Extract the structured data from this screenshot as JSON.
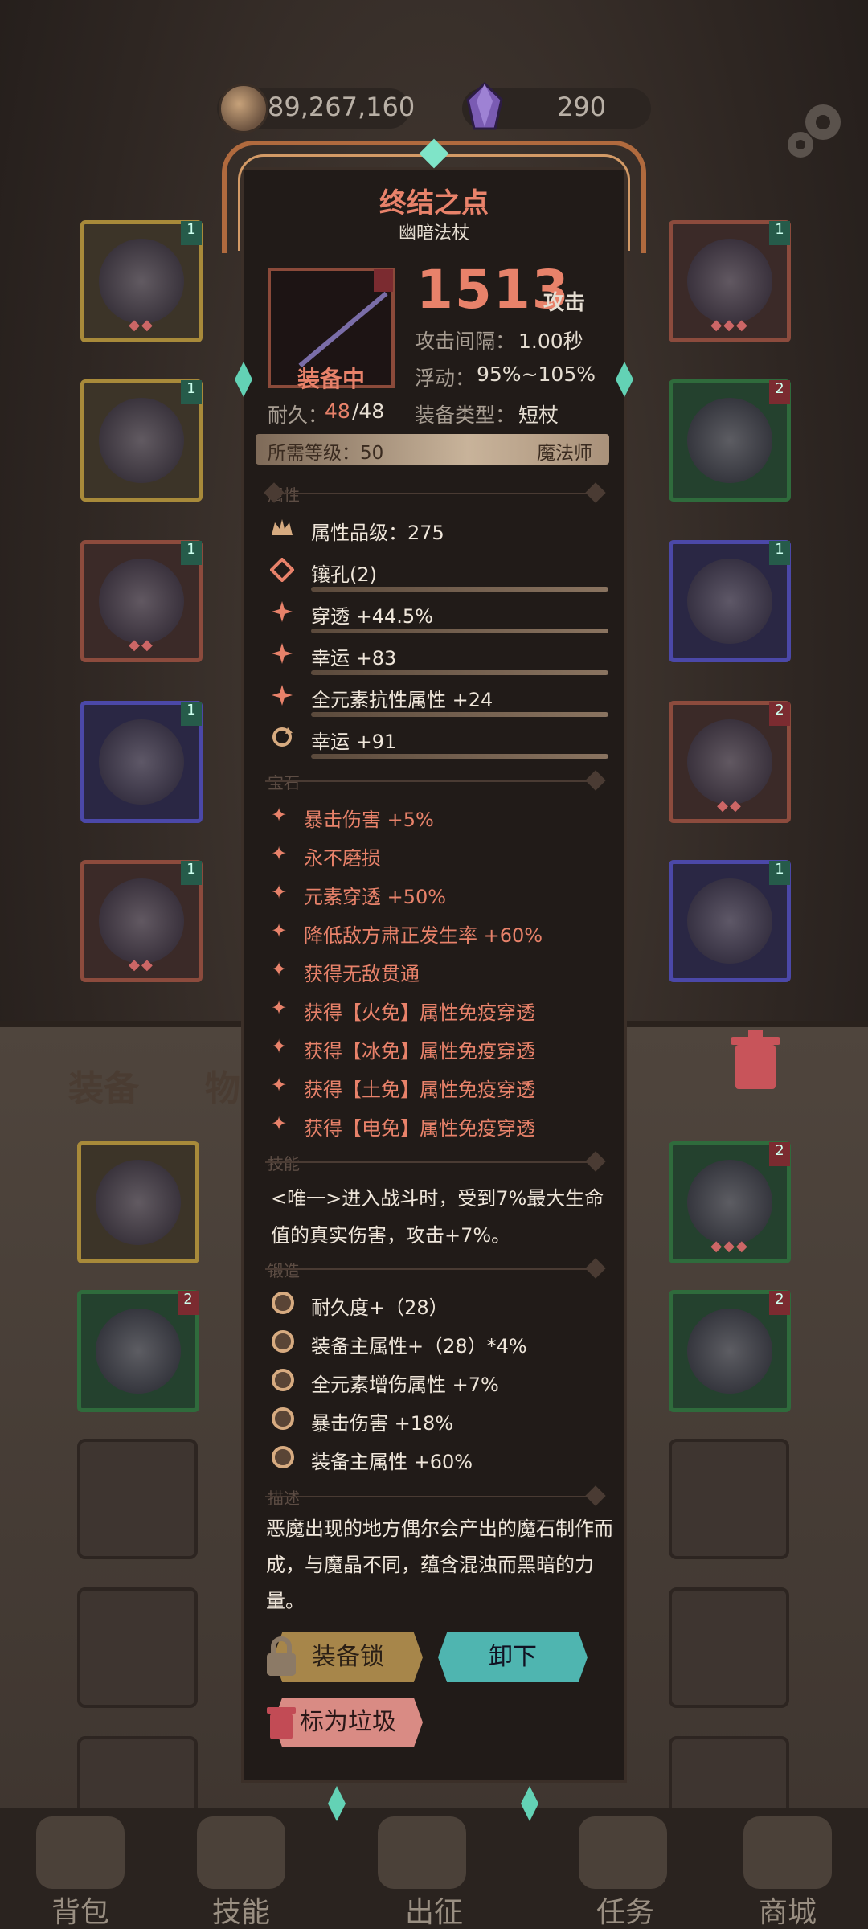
{
  "currency": {
    "coins": "89,267,160",
    "gems": "290"
  },
  "tabs": {
    "equipment": "装备",
    "items": "物品"
  },
  "item": {
    "name": "终结之点",
    "type_name": "幽暗法杖",
    "equipped_label": "装备中",
    "attack_value": "1513",
    "attack_unit": "攻击",
    "attack_interval_label": "攻击间隔：",
    "attack_interval_value": "1.00秒",
    "float_label": "浮动：",
    "float_value": "95%~105%",
    "equip_type_label": "装备类型：",
    "equip_type_value": "短杖",
    "durability_label": "耐久：",
    "durability_current": "48",
    "durability_max": "/48",
    "level_label": "所需等级：50",
    "class": "魔法师"
  },
  "sections": {
    "attributes": "属性",
    "gems": "宝石",
    "skill": "技能",
    "forge": "锻造",
    "description": "描述"
  },
  "attributes": [
    "属性品级：275",
    "镶孔(2)",
    "穿透 +44.5%",
    "幸运 +83",
    "全元素抗性属性 +24",
    "幸运 +91"
  ],
  "gem_effects": [
    "暴击伤害 +5%",
    "永不磨损",
    "元素穿透 +50%",
    "降低敌方肃正发生率 +60%",
    "获得无敌贯通",
    "获得【火免】属性免疫穿透",
    "获得【冰免】属性免疫穿透",
    "获得【土免】属性免疫穿透",
    "获得【电免】属性免疫穿透"
  ],
  "skill_text": "<唯一>进入战斗时，受到7%最大生命值的真实伤害，攻击+7%。",
  "forge_effects": [
    "耐久度+（28）",
    "装备主属性+（28）*4%",
    "全元素增伤属性 +7%",
    "暴击伤害 +18%",
    "装备主属性 +60%"
  ],
  "description": "恶魔出现的地方偶尔会产出的魔石制作而成，与魔晶不同，蕴含混浊而黑暗的力量。",
  "buttons": {
    "lock": "装备锁",
    "unequip": "卸下",
    "junk": "标为垃圾"
  },
  "nav": {
    "bag": "背包",
    "skills": "技能",
    "battle": "出征",
    "quests": "任务",
    "shop": "商城"
  },
  "colors": {
    "accent": "#e8826a",
    "teal": "#4fb5b0",
    "frame": "#b06a3e"
  }
}
